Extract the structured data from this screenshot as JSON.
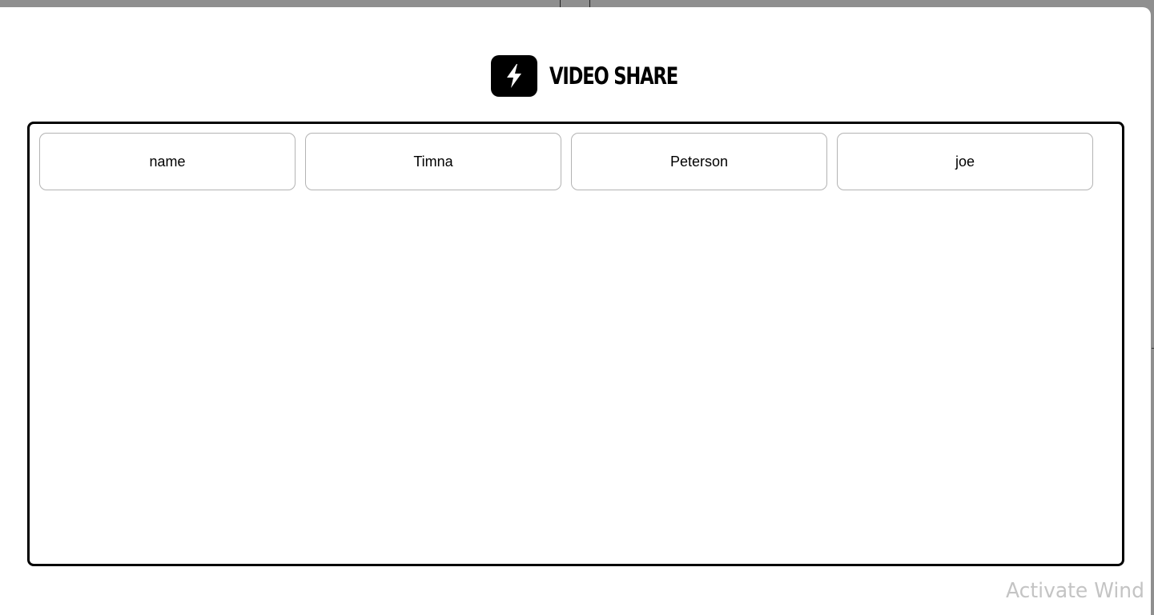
{
  "brand": {
    "title": "VIDEO SHARE",
    "logo_icon": "lightning-bolt-icon"
  },
  "participants": [
    {
      "label": "name"
    },
    {
      "label": "Timna"
    },
    {
      "label": "Peterson"
    },
    {
      "label": "joe"
    }
  ],
  "watermark": {
    "text": "Activate Wind"
  },
  "colors": {
    "backdrop": "#8f8f8f",
    "accent": "#000000",
    "tile_border": "#b3b3b3",
    "watermark": "#c4c4c4"
  }
}
